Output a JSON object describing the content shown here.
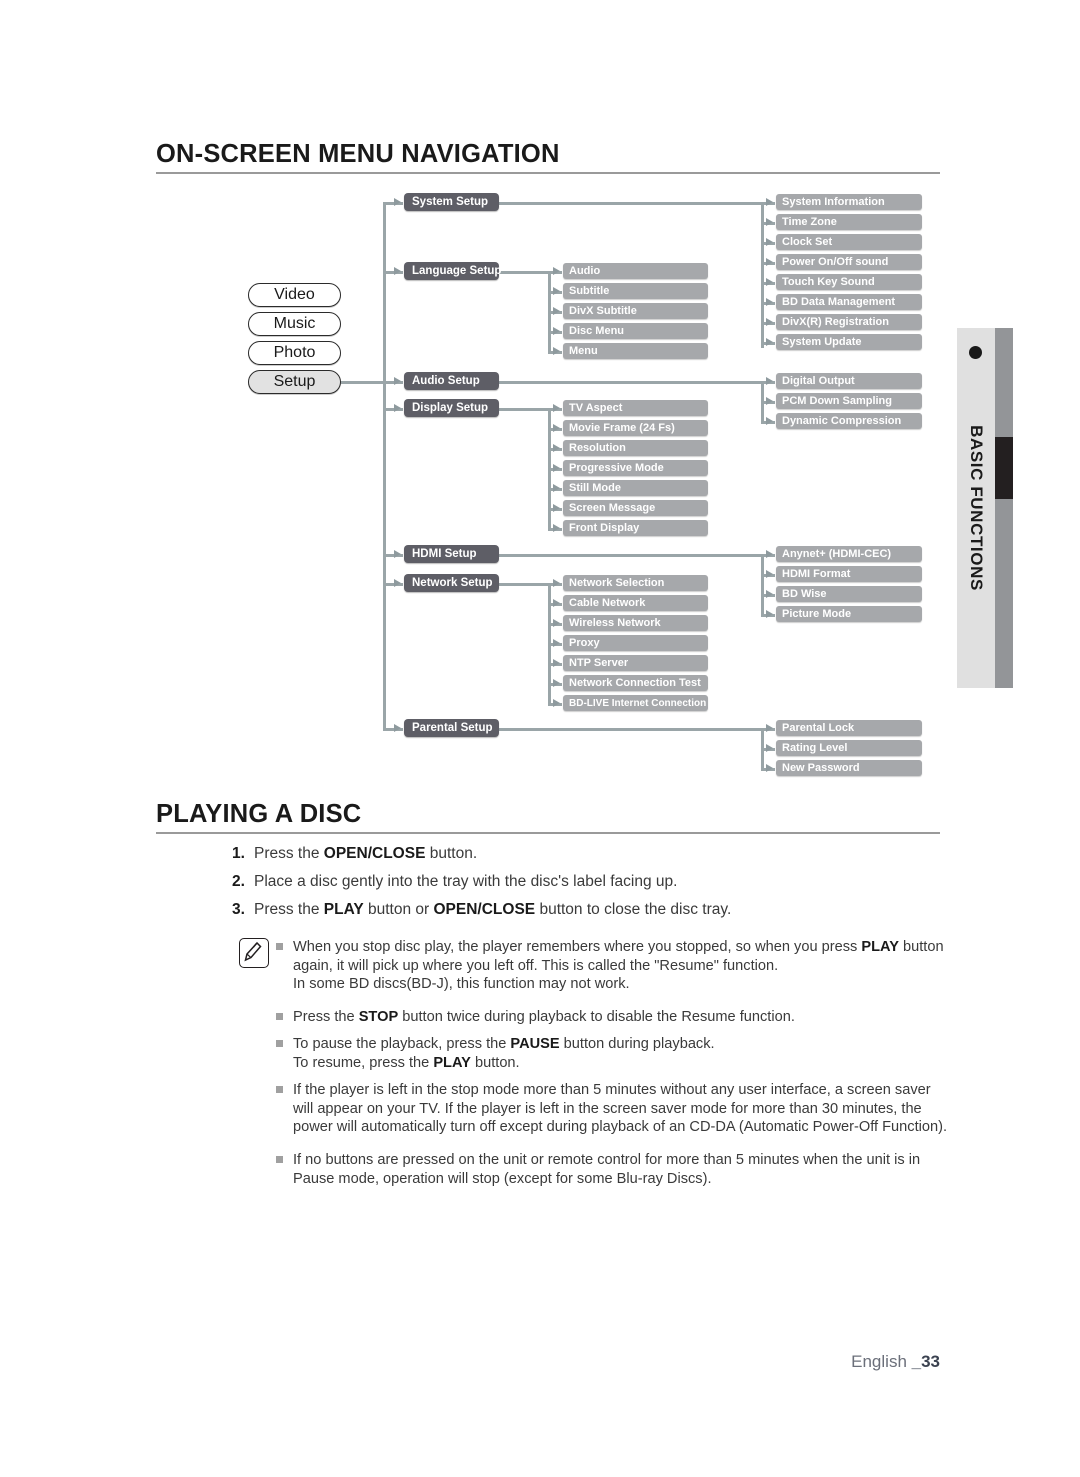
{
  "headings": {
    "on_screen_menu_navigation": "ON-SCREEN MENU NAVIGATION",
    "playing_a_disc": "PLAYING A DISC"
  },
  "side_tab": {
    "label": "BASIC FUNCTIONS",
    "dot_icon": "bullet-dot-icon"
  },
  "diagram": {
    "tier1": [
      {
        "label": "Video",
        "selected": false
      },
      {
        "label": "Music",
        "selected": false
      },
      {
        "label": "Photo",
        "selected": false
      },
      {
        "label": "Setup",
        "selected": true
      }
    ],
    "tier2": [
      {
        "label": "System Setup"
      },
      {
        "label": "Language Setup"
      },
      {
        "label": "Audio Setup"
      },
      {
        "label": "Display Setup"
      },
      {
        "label": "HDMI Setup"
      },
      {
        "label": "Network Setup"
      },
      {
        "label": "Parental Setup"
      }
    ],
    "system_setup_items": [
      "System Information",
      "Time Zone",
      "Clock Set",
      "Power On/Off sound",
      "Touch Key Sound",
      "BD Data Management",
      "DivX(R) Registration",
      "System Update"
    ],
    "language_setup_items": [
      "Audio",
      "Subtitle",
      "DivX Subtitle",
      "Disc Menu",
      "Menu"
    ],
    "audio_setup_items": [
      "Digital Output",
      "PCM Down Sampling",
      "Dynamic Compression"
    ],
    "display_setup_items": [
      "TV Aspect",
      "Movie Frame (24 Fs)",
      "Resolution",
      "Progressive Mode",
      "Still Mode",
      "Screen Message",
      "Front Display"
    ],
    "hdmi_setup_items": [
      "Anynet+ (HDMI-CEC)",
      "HDMI Format",
      "BD Wise",
      "Picture Mode"
    ],
    "network_setup_items": [
      "Network Selection",
      "Cable Network",
      "Wireless Network",
      "Proxy",
      "NTP Server",
      "Network Connection Test",
      "BD-LIVE Internet Connection"
    ],
    "parental_setup_items": [
      "Parental Lock",
      "Rating Level",
      "New Password"
    ]
  },
  "steps": [
    {
      "num": "1.",
      "html": "Press the <b>OPEN/CLOSE</b> button."
    },
    {
      "num": "2.",
      "html": "Place a disc gently into the tray with the disc's label facing up."
    },
    {
      "num": "3.",
      "html": "Press the <b>PLAY</b> button or <b>OPEN/CLOSE</b> button to close the disc tray."
    }
  ],
  "note_icon": "memo-pencil-icon",
  "notes": [
    {
      "html": "When you stop disc play, the player remembers where you stopped, so when you press <b>PLAY</b> button again, it will pick up where you left off. This is called the \"Resume\" function.<br>In some BD discs(BD-J), this function may not work."
    },
    {
      "html": "Press the <b>STOP</b> button twice during playback to disable the Resume function."
    },
    {
      "html": "To pause the playback, press the <b>PAUSE</b> button during playback.<br>To resume, press the <b>PLAY</b> button."
    },
    {
      "html": "If the player is left in the stop mode more than 5 minutes without any user interface, a screen saver will appear on your TV. If the player is left in the screen saver mode for more than 30 minutes, the power will automatically turn off except during playback of an CD-DA (Automatic Power-Off Function)."
    },
    {
      "html": "If no buttons are pressed on the unit or remote control for more than 5 minutes when the unit is in Pause mode, operation will stop (except for some Blu-ray Discs)."
    }
  ],
  "footer": {
    "language": "English ",
    "page": "_33"
  },
  "colors": {
    "tier2_fill": "#5e5e66",
    "tier3_fill": "#a6a8ab",
    "connector": "#9aa5a8",
    "side_bar": "#939598",
    "side_tab": "#e0e0e0"
  }
}
